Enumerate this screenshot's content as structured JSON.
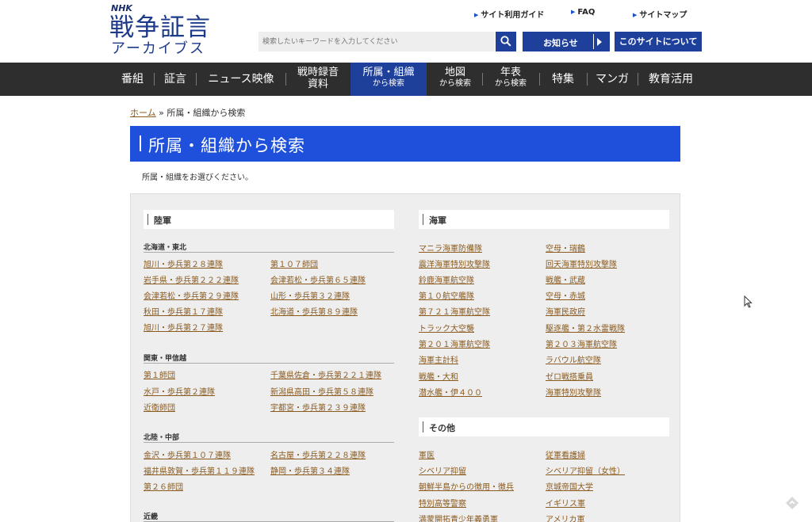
{
  "header": {
    "logo_top": "NHK",
    "logo_main": "戦争証言",
    "logo_sub": "アーカイブス",
    "links": [
      "サイト利用ガイド",
      "FAQ",
      "サイトマップ"
    ],
    "search_placeholder": "検索したいキーワードを入力してください",
    "notice_button": "お知らせ",
    "about_button": "このサイトについて"
  },
  "nav": {
    "items": [
      {
        "l1": "番組",
        "l2": ""
      },
      {
        "l1": "証言",
        "l2": ""
      },
      {
        "l1": "ニュース映像",
        "l2": ""
      },
      {
        "l1": "戦時録音",
        "l2": "資料"
      },
      {
        "l1": "所属・組織",
        "l2": "から検索"
      },
      {
        "l1": "地図",
        "l2": "から検索"
      },
      {
        "l1": "年表",
        "l2": "から検索"
      },
      {
        "l1": "特集",
        "l2": ""
      },
      {
        "l1": "マンガ",
        "l2": ""
      },
      {
        "l1": "教育活用",
        "l2": ""
      }
    ],
    "active_index": 4
  },
  "breadcrumb": {
    "home": "ホーム",
    "separator": "»",
    "current": "所属・組織から検索"
  },
  "page_title": "所属・組織から検索",
  "instruction": "所属・組織をお選びください。",
  "army": {
    "heading": "陸軍",
    "regions": [
      {
        "name": "北海道・東北",
        "links": [
          "旭川・歩兵第２８連隊",
          "第１０７師団",
          "岩手県・歩兵第２２２連隊",
          "会津若松・歩兵第６５連隊",
          "会津若松・歩兵第２９連隊",
          "山形・歩兵第３２連隊",
          "秋田・歩兵第１７連隊",
          "北海道・歩兵第８９連隊",
          "旭川・歩兵第２７連隊"
        ]
      },
      {
        "name": "関東・甲信越",
        "links": [
          "第１師団",
          "千葉県佐倉・歩兵第２２１連隊",
          "水戸・歩兵第２連隊",
          "新潟県高田・歩兵第５８連隊",
          "近衛師団",
          "宇都宮・歩兵第２３９連隊"
        ]
      },
      {
        "name": "北陸・中部",
        "links": [
          "金沢・歩兵第１０７連隊",
          "名古屋・歩兵第２２８連隊",
          "福井県敦賀・歩兵第１１９連隊",
          "静岡・歩兵第３４連隊",
          "第２６師団"
        ]
      },
      {
        "name": "近畿",
        "links": []
      }
    ]
  },
  "navy": {
    "heading": "海軍",
    "links": [
      "マニラ海軍防備隊",
      "空母・瑞鶴",
      "震洋海軍特別攻撃隊",
      "回天海軍特別攻撃隊",
      "鈴鹿海軍航空隊",
      "戦艦・武蔵",
      "第１０航空艦隊",
      "空母・赤城",
      "第７２１海軍航空隊",
      "海軍民政府",
      "トラック大空襲",
      "駆逐艦・第２水雷戦隊",
      "第２０１海軍航空隊",
      "第２０３海軍航空隊",
      "海軍主計科",
      "ラバウル航空隊",
      "戦艦・大和",
      "ゼロ戦搭乗員",
      "潜水艦・伊４００",
      "海軍特別攻撃隊"
    ]
  },
  "other": {
    "heading": "その他",
    "links": [
      "軍医",
      "従軍看護婦",
      "シベリア抑留",
      "シベリア抑留（女性）",
      "朝鮮半島からの徴用・徴兵",
      "京城帝国大学",
      "特別高等警察",
      "イギリス軍",
      "満蒙開拓青少年義勇軍",
      "アメリカ軍"
    ]
  },
  "colors": {
    "brand_blue": "#1e3f9a",
    "banner_blue": "#1e50dc",
    "nav_bg": "#2e2e2e",
    "link": "#8b5a1e"
  }
}
